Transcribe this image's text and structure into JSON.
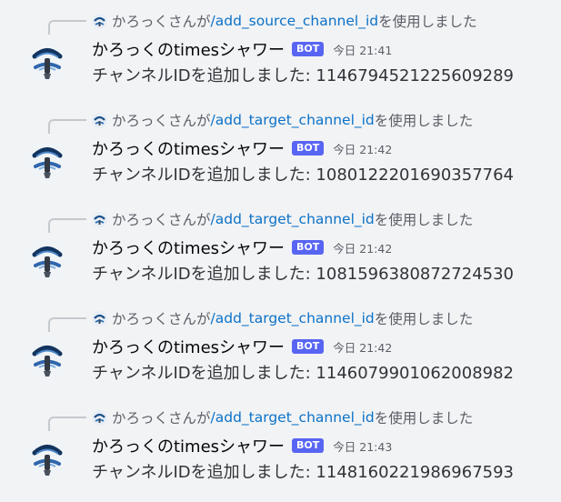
{
  "messages": [
    {
      "context": {
        "user": "かろっくさんが",
        "command": "/add_source_channel_id",
        "suffix": "を使用しました"
      },
      "author": "かろっくのtimesシャワー",
      "badge": "BOT",
      "time": "今日 21:41",
      "content": "チャンネルIDを追加しました: 1146794521225609289"
    },
    {
      "context": {
        "user": "かろっくさんが",
        "command": "/add_target_channel_id",
        "suffix": "を使用しました"
      },
      "author": "かろっくのtimesシャワー",
      "badge": "BOT",
      "time": "今日 21:42",
      "content": "チャンネルIDを追加しました: 1080122201690357764"
    },
    {
      "context": {
        "user": "かろっくさんが",
        "command": "/add_target_channel_id",
        "suffix": "を使用しました"
      },
      "author": "かろっくのtimesシャワー",
      "badge": "BOT",
      "time": "今日 21:42",
      "content": "チャンネルIDを追加しました: 1081596380872724530"
    },
    {
      "context": {
        "user": "かろっくさんが",
        "command": "/add_target_channel_id",
        "suffix": "を使用しました"
      },
      "author": "かろっくのtimesシャワー",
      "badge": "BOT",
      "time": "今日 21:42",
      "content": "チャンネルIDを追加しました: 1146079901062008982"
    },
    {
      "context": {
        "user": "かろっくさんが",
        "command": "/add_target_channel_id",
        "suffix": "を使用しました"
      },
      "author": "かろっくのtimesシャワー",
      "badge": "BOT",
      "time": "今日 21:43",
      "content": "チャンネルIDを追加しました: 1148160221986967593"
    }
  ],
  "colors": {
    "background": "#f2f3f5",
    "bot_badge": "#5865f2",
    "command_link": "#0c72c7",
    "muted_text": "#5c5e66",
    "reply_line": "#c4c9ce"
  },
  "icons": {
    "avatar": "shower-head-avatar-icon",
    "mini_avatar": "user-avatar-icon"
  }
}
